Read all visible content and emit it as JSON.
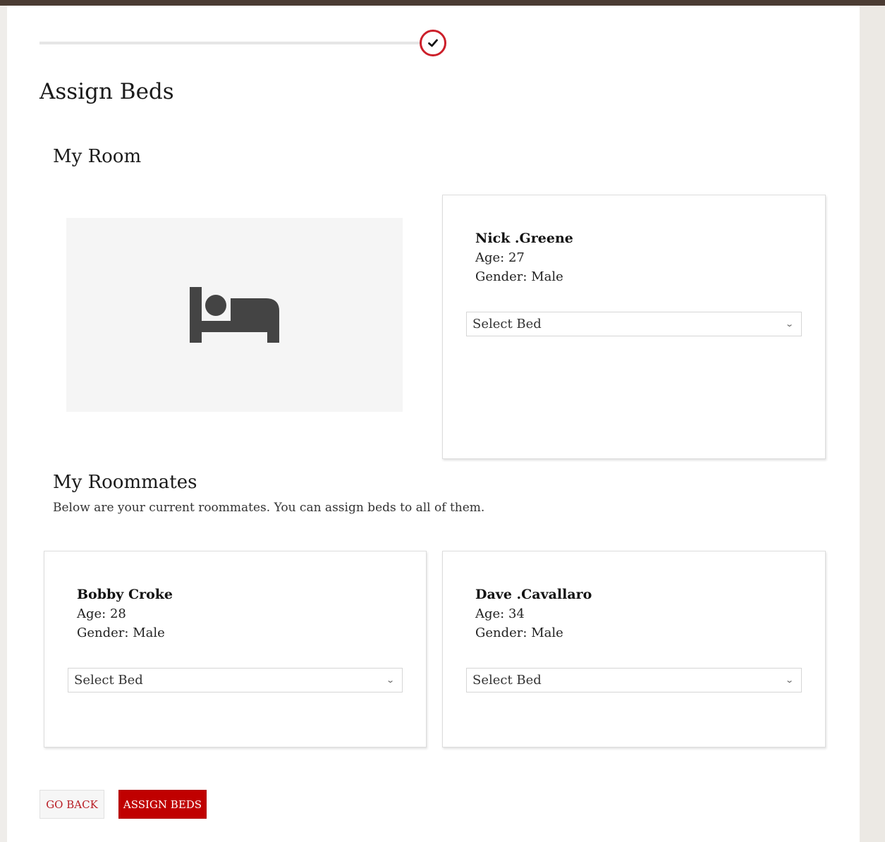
{
  "colors": {
    "accent": "#c00000",
    "progress_ring": "#cc1f2a",
    "top_bar": "#4b3c33",
    "side_panel": "#ece9e4"
  },
  "progress": {
    "icon": "check-icon",
    "fill": 1.0
  },
  "page": {
    "title": "Assign Beds"
  },
  "my_room": {
    "heading": "My Room",
    "image_icon": "bed-icon",
    "occupant": {
      "name": "Nick .Greene",
      "age": "Age: 27",
      "gender": "Gender: Male",
      "select_bed": "Select Bed"
    }
  },
  "roommates": {
    "heading": "My Roommates",
    "description": "Below are your current roommates. You can assign beds to all of them.",
    "items": [
      {
        "name": "Bobby Croke",
        "age": "Age: 28",
        "gender": "Gender: Male",
        "select_bed": "Select Bed"
      },
      {
        "name": "Dave .Cavallaro",
        "age": "Age: 34",
        "gender": "Gender: Male",
        "select_bed": "Select Bed"
      }
    ]
  },
  "actions": {
    "go_back": "GO BACK",
    "assign_beds": "ASSIGN BEDS"
  }
}
